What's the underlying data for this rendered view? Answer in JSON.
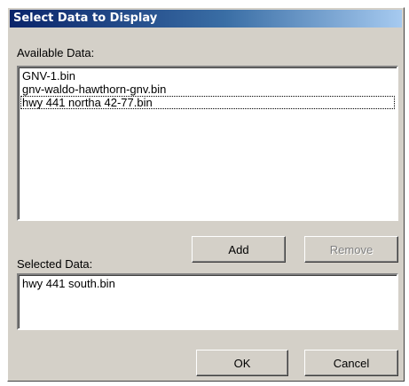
{
  "window": {
    "title": "Select Data to Display"
  },
  "available": {
    "label": "Available Data:",
    "items": [
      "GNV-1.bin",
      "gnv-waldo-hawthorn-gnv.bin",
      "hwy 441 northa 42-77.bin"
    ],
    "focused_index": 2
  },
  "selected": {
    "label": "Selected Data:",
    "items": [
      "hwy 441 south.bin"
    ]
  },
  "buttons": {
    "add": "Add",
    "remove": "Remove",
    "remove_enabled": false,
    "ok": "OK",
    "cancel": "Cancel"
  }
}
